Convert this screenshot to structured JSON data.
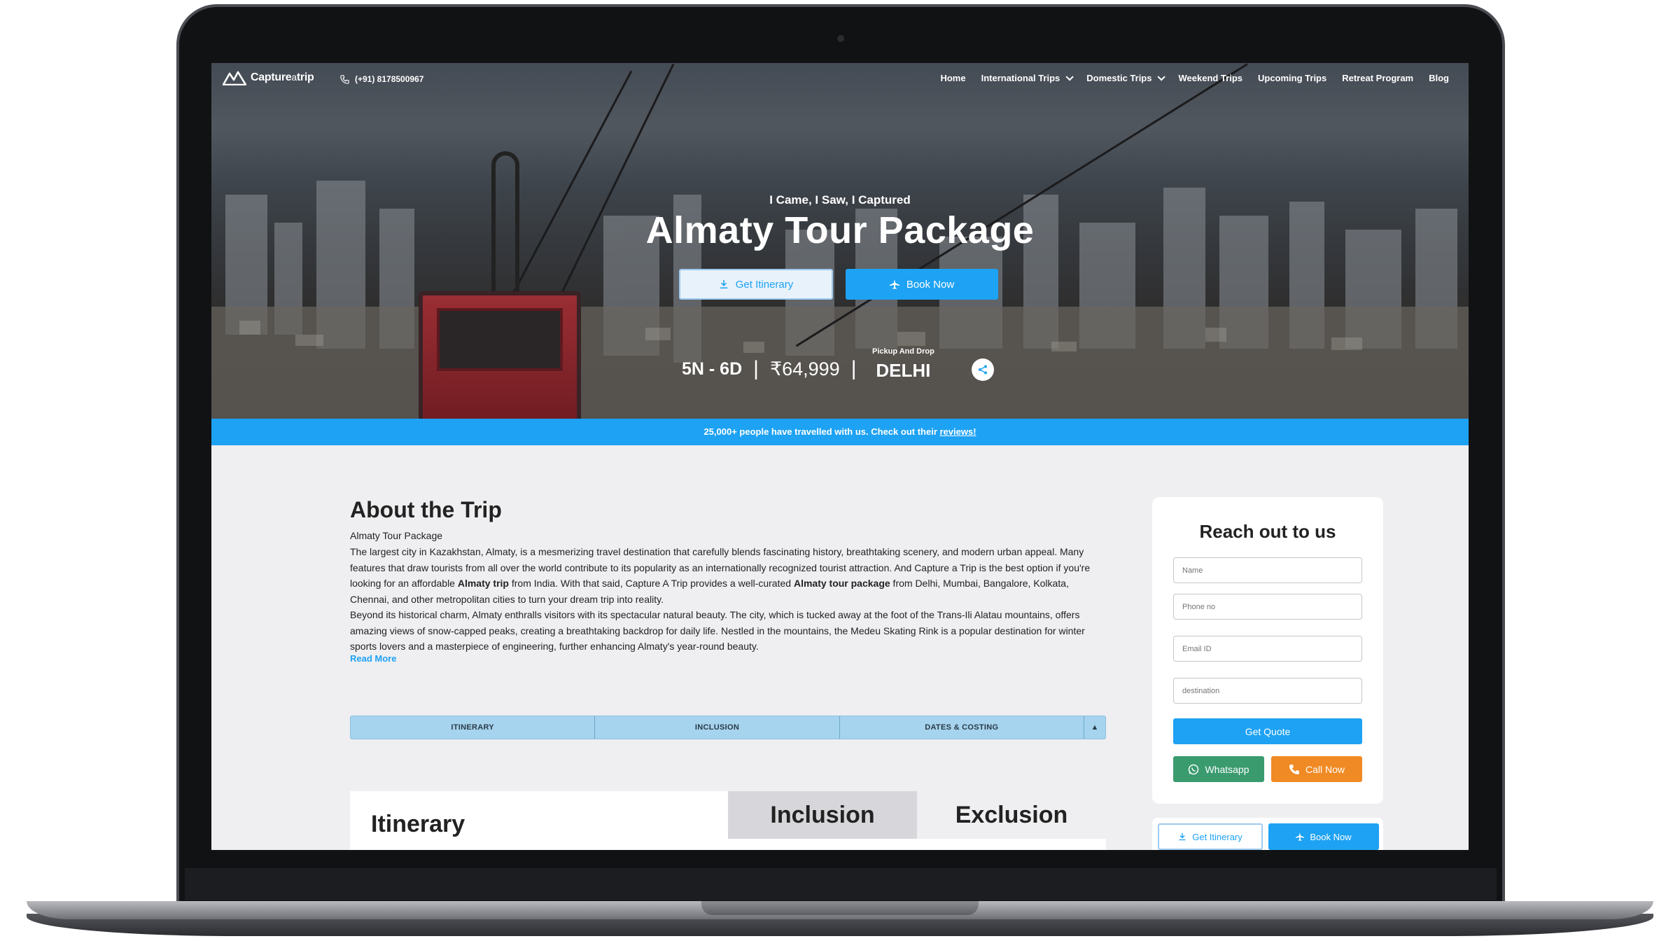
{
  "brand": {
    "name_main": "Capture",
    "name_a": "a",
    "name_trip": "trip"
  },
  "header": {
    "phone": "(+91) 8178500967",
    "nav": [
      {
        "label": "Home"
      },
      {
        "label": "International Trips"
      },
      {
        "label": "Domestic Trips"
      },
      {
        "label": "Weekend Trips"
      },
      {
        "label": "Upcoming Trips"
      },
      {
        "label": "Retreat Program"
      },
      {
        "label": "Blog"
      }
    ]
  },
  "hero": {
    "tagline": "I Came, I Saw, I Captured",
    "title": "Almaty Tour Package",
    "itinerary_button": "Get Itinerary",
    "book_button": "Book Now",
    "duration": "5N - 6D",
    "separator": "|",
    "price": "₹64,999",
    "pickup_label": "Pickup And Drop",
    "pickup_city": "DELHI"
  },
  "banner": {
    "text": "25,000+ people have travelled with us. Check out their ",
    "link": "reviews!"
  },
  "about": {
    "title": "About the Trip",
    "subtitle": "Almaty Tour Package",
    "p1_a": "The largest city in Kazakhstan, Almaty, is a mesmerizing travel destination that carefully blends fascinating history, breathtaking scenery, and modern urban appeal. Many features that draw tourists from all over the world contribute to its popularity as an internationally recognized tourist attraction. And Capture a Trip is the best option if you're looking for an affordable ",
    "p1_b": "Almaty trip",
    "p1_c": " from India. With that said, Capture A Trip provides a well-curated ",
    "p1_d": "Almaty tour package",
    "p1_e": " from Delhi, Mumbai, Bangalore, Kolkata, Chennai, and other metropolitan cities to turn your dream trip into reality.",
    "p2": "Beyond its historical charm, Almaty enthralls visitors with its spectacular natural beauty. The city, which is tucked away at the foot of the Trans-Ili Alatau mountains, offers amazing views of snow-capped peaks, creating a breathtaking backdrop for daily life. Nestled in the mountains, the Medeu Skating Rink is a popular destination for winter sports lovers and a masterpiece of engineering, further enhancing Almaty's year-round beauty.",
    "read_more": "Read More"
  },
  "tabs": [
    {
      "label": "ITINERARY"
    },
    {
      "label": "INCLUSION"
    },
    {
      "label": "DATES & COSTING"
    }
  ],
  "tabs_arrow": "▲",
  "sections": {
    "itinerary": "Itinerary",
    "inclusion": "Inclusion",
    "exclusion": "Exclusion"
  },
  "form": {
    "title": "Reach out to us",
    "name_placeholder": "Name",
    "phone_placeholder": "Phone no",
    "email_placeholder": "Email ID",
    "destination_placeholder": "destination",
    "quote_button": "Get Quote",
    "whatsapp_button": "Whatsapp",
    "call_button": "Call Now"
  },
  "sticky": {
    "itinerary_button": "Get Itinerary",
    "book_button": "Book Now"
  },
  "colors": {
    "accent": "#1ea2f3",
    "whatsapp": "#3a9b6f",
    "call": "#f08a24",
    "tab_bg": "#a6d3ee"
  }
}
